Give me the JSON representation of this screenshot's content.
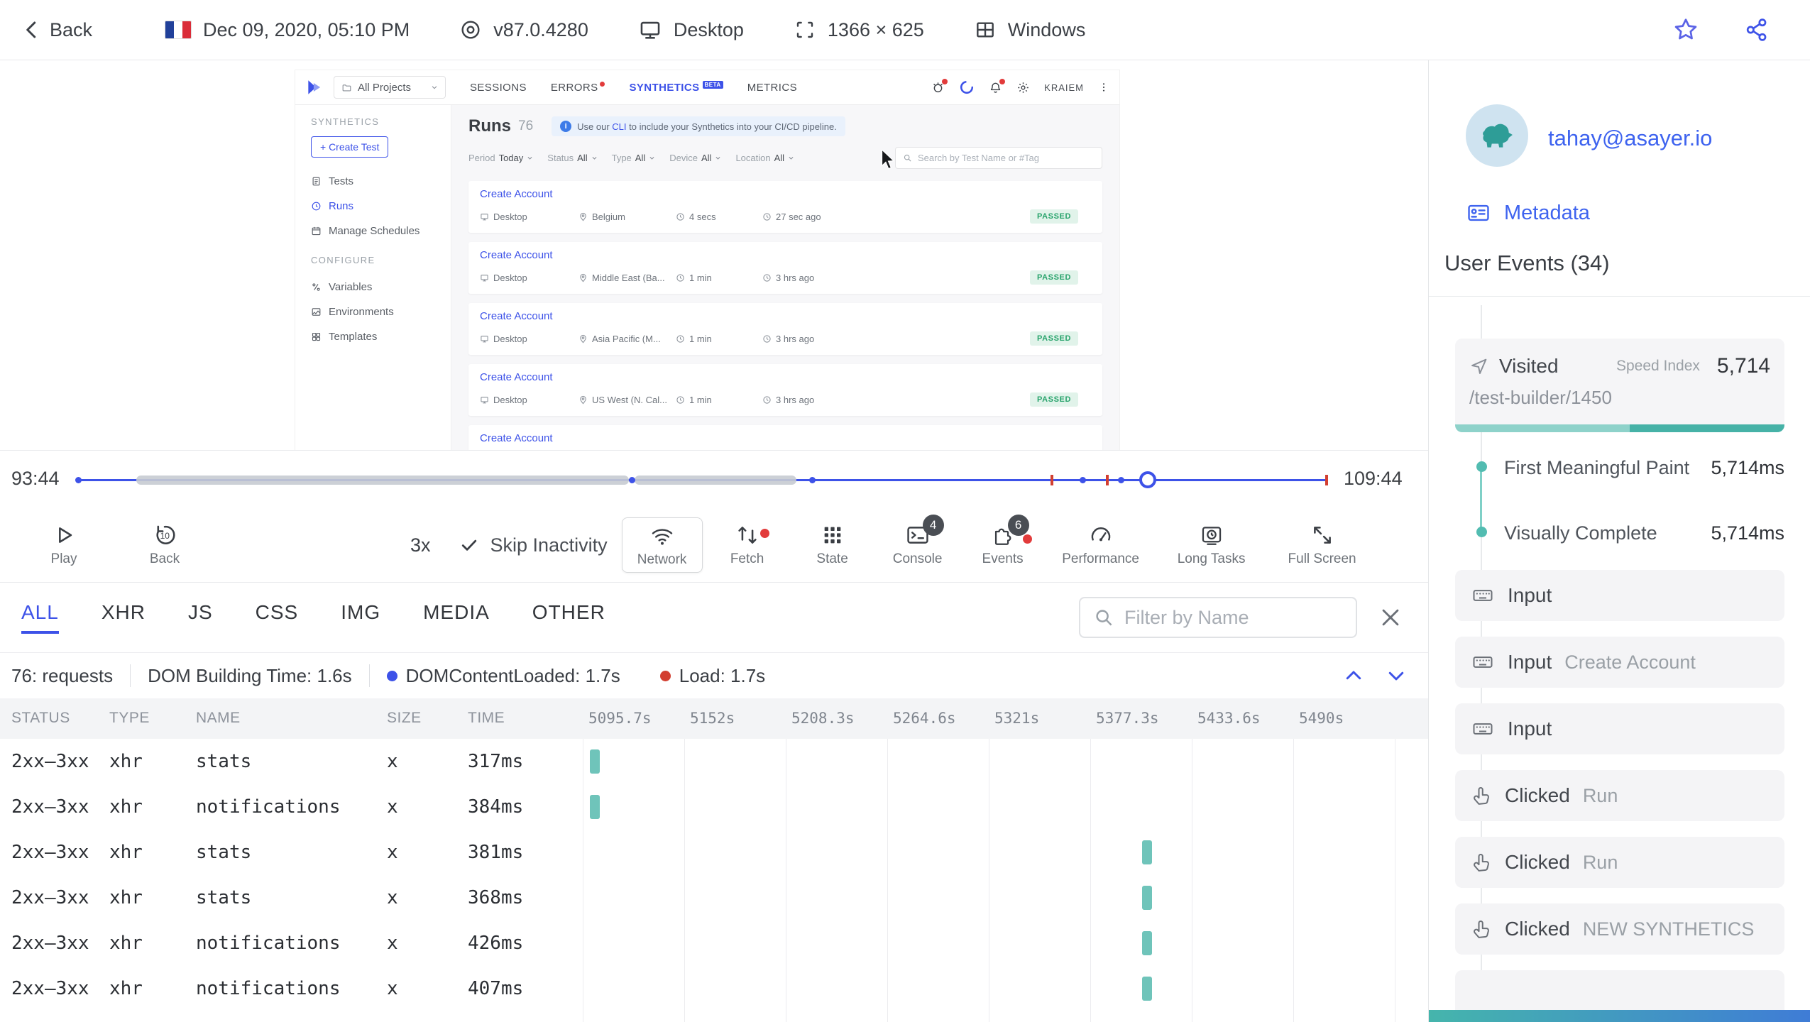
{
  "header": {
    "back": "Back",
    "session_date": "Dec 09, 2020, 05:10 PM",
    "browser_version": "v87.0.4280",
    "device": "Desktop",
    "resolution": "1366 × 625",
    "os": "Windows"
  },
  "app": {
    "project_selector": "All Projects",
    "nav_tabs": {
      "sessions": "SESSIONS",
      "errors": "ERRORS",
      "synthetics": "SYNTHETICS",
      "synthetics_badge": "BETA",
      "metrics": "METRICS"
    },
    "user_menu": "KRAIEM",
    "sidebar": {
      "section_synthetics": "SYNTHETICS",
      "create_test": "+ Create Test",
      "tests": "Tests",
      "runs": "Runs",
      "manage_schedules": "Manage Schedules",
      "section_configure": "CONFIGURE",
      "variables": "Variables",
      "environments": "Environments",
      "templates": "Templates"
    },
    "content": {
      "title": "Runs",
      "count": "76",
      "banner": {
        "pre": "Use our",
        "link": "CLI",
        "post": "to include your Synthetics into your CI/CD pipeline."
      },
      "filters": [
        {
          "label": "Period",
          "value": "Today"
        },
        {
          "label": "Status",
          "value": "All"
        },
        {
          "label": "Type",
          "value": "All"
        },
        {
          "label": "Device",
          "value": "All"
        },
        {
          "label": "Location",
          "value": "All"
        }
      ],
      "search_placeholder": "Search by Test Name or #Tag",
      "runs": [
        {
          "name": "Create Account",
          "device": "Desktop",
          "location": "Belgium",
          "duration": "4 secs",
          "ago": "27 sec ago",
          "status": "PASSED"
        },
        {
          "name": "Create Account",
          "device": "Desktop",
          "location": "Middle East (Ba...",
          "duration": "1 min",
          "ago": "3 hrs ago",
          "status": "PASSED"
        },
        {
          "name": "Create Account",
          "device": "Desktop",
          "location": "Asia Pacific (M...",
          "duration": "1 min",
          "ago": "3 hrs ago",
          "status": "PASSED"
        },
        {
          "name": "Create Account",
          "device": "Desktop",
          "location": "US West (N. Cal...",
          "duration": "1 min",
          "ago": "3 hrs ago",
          "status": "PASSED"
        },
        {
          "name": "Create Account"
        }
      ]
    }
  },
  "player": {
    "current_time": "93:44",
    "end_time": "109:44",
    "play": "Play",
    "back": "Back",
    "back_seconds": "10",
    "speed": "3x",
    "skip_inactivity": "Skip Inactivity",
    "buttons": {
      "network": "Network",
      "fetch": "Fetch",
      "state": "State",
      "console": "Console",
      "console_count": "4",
      "events": "Events",
      "events_count": "6",
      "performance": "Performance",
      "long_tasks": "Long Tasks",
      "full_screen": "Full Screen"
    }
  },
  "network": {
    "tabs": [
      "ALL",
      "XHR",
      "JS",
      "CSS",
      "IMG",
      "MEDIA",
      "OTHER"
    ],
    "filter_placeholder": "Filter by Name",
    "summary": {
      "requests": "76: requests",
      "dom_building_time": "DOM Building Time: 1.6s",
      "dom_content_loaded": "DOMContentLoaded: 1.7s",
      "load": "Load: 1.7s"
    },
    "columns": {
      "status": "STATUS",
      "type": "TYPE",
      "name": "NAME",
      "size": "SIZE",
      "time": "TIME"
    },
    "time_ticks": [
      "5095.7s",
      "5152s",
      "5208.3s",
      "5264.6s",
      "5321s",
      "5377.3s",
      "5433.6s",
      "5490s"
    ],
    "rows": [
      {
        "status": "2xx–3xx",
        "type": "xhr",
        "name": "stats",
        "size": "x",
        "time": "317ms",
        "bar_col": 0
      },
      {
        "status": "2xx–3xx",
        "type": "xhr",
        "name": "notifications",
        "size": "x",
        "time": "384ms",
        "bar_col": 0
      },
      {
        "status": "2xx–3xx",
        "type": "xhr",
        "name": "stats",
        "size": "x",
        "time": "381ms",
        "bar_col": 5
      },
      {
        "status": "2xx–3xx",
        "type": "xhr",
        "name": "stats",
        "size": "x",
        "time": "368ms",
        "bar_col": 5
      },
      {
        "status": "2xx–3xx",
        "type": "xhr",
        "name": "notifications",
        "size": "x",
        "time": "426ms",
        "bar_col": 5
      },
      {
        "status": "2xx–3xx",
        "type": "xhr",
        "name": "notifications",
        "size": "x",
        "time": "407ms",
        "bar_col": 5
      }
    ]
  },
  "user_panel": {
    "email": "tahay@asayer.io",
    "metadata": "Metadata",
    "title": "User Events (34)",
    "visited": {
      "label": "Visited",
      "speed_index_label": "Speed Index",
      "speed_index": "5,714",
      "url": "/test-builder/1450",
      "first_meaningful_paint_label": "First Meaningful Paint",
      "first_meaningful_paint": "5,714ms",
      "visually_complete_label": "Visually Complete",
      "visually_complete": "5,714ms"
    },
    "events": [
      {
        "type": "input",
        "label": "Input",
        "detail": ""
      },
      {
        "type": "input",
        "label": "Input",
        "detail": "Create Account"
      },
      {
        "type": "input",
        "label": "Input",
        "detail": ""
      },
      {
        "type": "click",
        "label": "Clicked",
        "detail": "Run"
      },
      {
        "type": "click",
        "label": "Clicked",
        "detail": "Run"
      },
      {
        "type": "click",
        "label": "Clicked",
        "detail": "NEW SYNTHETICS"
      }
    ]
  },
  "colors": {
    "accent": "#3d52e8",
    "teal": "#52bcb1",
    "red": "#d23f31",
    "green": "#27a36b"
  }
}
